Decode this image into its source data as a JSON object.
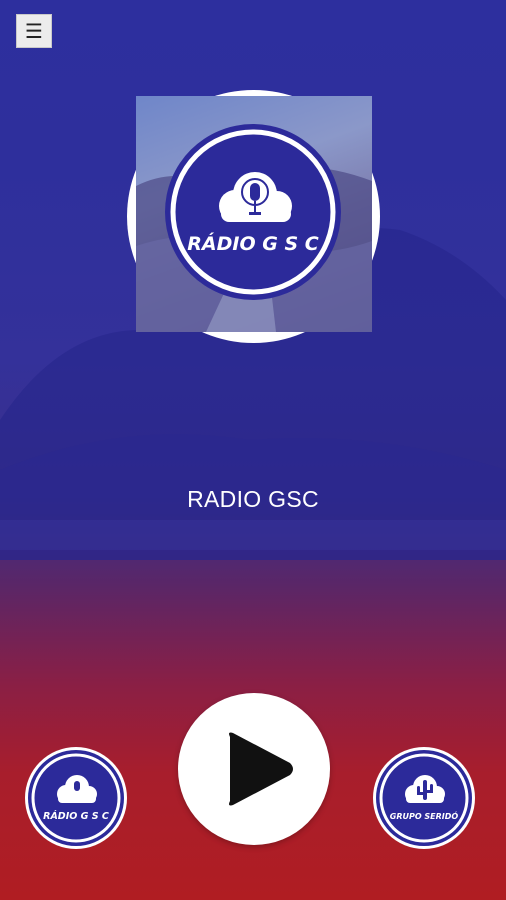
{
  "menu": {
    "icon": "hamburger-menu-icon",
    "glyph": "☰"
  },
  "station": {
    "name": "RADIO GSC"
  },
  "logo_main": {
    "text": "RÁDIO G S C"
  },
  "logo_mini_left": {
    "text": "RÁDIO G S C"
  },
  "logo_mini_right": {
    "text": "GRUPO SERIDÓ"
  },
  "player": {
    "icon": "play-icon"
  },
  "colors": {
    "brand_blue": "#2c2a9a",
    "white": "#ffffff",
    "bottom_red": "#b01d22"
  }
}
